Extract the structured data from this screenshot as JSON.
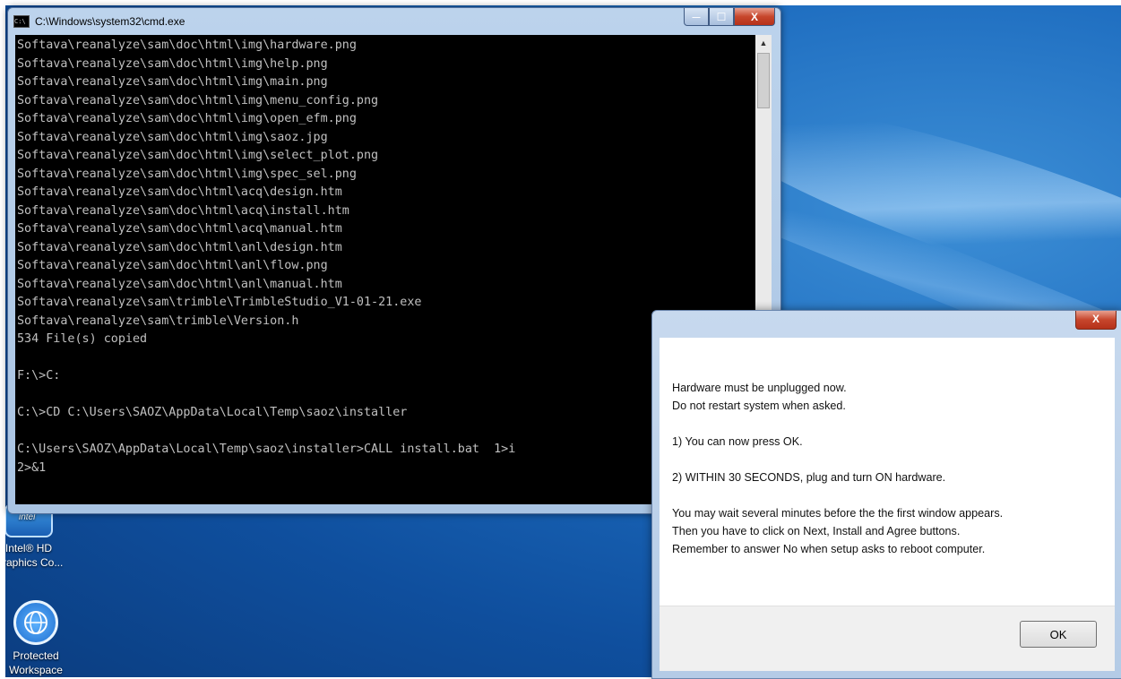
{
  "cmd": {
    "title": "C:\\Windows\\system32\\cmd.exe",
    "app_icon_text": "C:\\",
    "lines": [
      "Softava\\reanalyze\\sam\\doc\\html\\img\\hardware.png",
      "Softava\\reanalyze\\sam\\doc\\html\\img\\help.png",
      "Softava\\reanalyze\\sam\\doc\\html\\img\\main.png",
      "Softava\\reanalyze\\sam\\doc\\html\\img\\menu_config.png",
      "Softava\\reanalyze\\sam\\doc\\html\\img\\open_efm.png",
      "Softava\\reanalyze\\sam\\doc\\html\\img\\saoz.jpg",
      "Softava\\reanalyze\\sam\\doc\\html\\img\\select_plot.png",
      "Softava\\reanalyze\\sam\\doc\\html\\img\\spec_sel.png",
      "Softava\\reanalyze\\sam\\doc\\html\\acq\\design.htm",
      "Softava\\reanalyze\\sam\\doc\\html\\acq\\install.htm",
      "Softava\\reanalyze\\sam\\doc\\html\\acq\\manual.htm",
      "Softava\\reanalyze\\sam\\doc\\html\\anl\\design.htm",
      "Softava\\reanalyze\\sam\\doc\\html\\anl\\flow.png",
      "Softava\\reanalyze\\sam\\doc\\html\\anl\\manual.htm",
      "Softava\\reanalyze\\sam\\trimble\\TrimbleStudio_V1-01-21.exe",
      "Softava\\reanalyze\\sam\\trimble\\Version.h",
      "534 File(s) copied",
      "",
      "F:\\>C:",
      "",
      "C:\\>CD C:\\Users\\SAOZ\\AppData\\Local\\Temp\\saoz\\installer",
      "",
      "C:\\Users\\SAOZ\\AppData\\Local\\Temp\\saoz\\installer>CALL install.bat  1>i",
      "2>&1"
    ],
    "buttons": {
      "minimize": "—",
      "maximize": "☐",
      "close": "X"
    },
    "scroll_up": "▲"
  },
  "desktop": {
    "icons": [
      {
        "label": "Intel® HD Graphics Co...",
        "icon": "intel-graphics-icon"
      },
      {
        "label": "Protected Workspace",
        "icon": "protected-workspace-icon"
      }
    ]
  },
  "dialog": {
    "close_label": "X",
    "lines": [
      "Hardware must be unplugged now.",
      "Do not restart system when asked.",
      "",
      "1) You can now press OK.",
      "",
      "2) WITHIN 30 SECONDS, plug and turn ON hardware.",
      "",
      "You may wait several minutes before the the first window appears.",
      "Then you have to click on Next, Install and Agree buttons.",
      "Remember to answer No when setup asks to reboot computer."
    ],
    "ok_label": "OK"
  }
}
